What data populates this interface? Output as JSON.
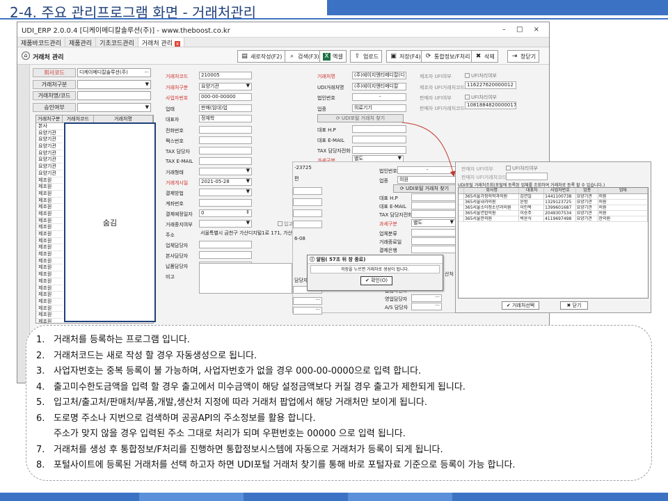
{
  "slide": {
    "title": "2-4. 주요 관리프로그램 화면 - 거래처관리"
  },
  "window": {
    "title": "UDI_ERP 2.0.0.4 [디케이메디칼솔루션(주)] - www.theboost.co.kr",
    "controls": "– □ ×",
    "menus": [
      "제품바코드관리",
      "제품관리",
      "기초코드관리",
      "거래처 관리"
    ],
    "active_close": "x",
    "screen_name": "거래처 관리"
  },
  "toolbar": [
    {
      "icon": "document-icon",
      "glyph": "▤",
      "label": "새로작성(F2)"
    },
    {
      "icon": "search-icon",
      "glyph": "⌕",
      "label": "검색(F3)"
    },
    {
      "icon": "excel-icon",
      "glyph": "X",
      "label": "엑셀"
    },
    {
      "icon": "upload-icon",
      "glyph": "⇪",
      "label": "업로드"
    },
    {
      "icon": "save-icon",
      "glyph": "▣",
      "label": "저장(F4)"
    },
    {
      "icon": "sync-icon",
      "glyph": "⟳",
      "label": "통합정보/F처리"
    },
    {
      "icon": "delete-icon",
      "glyph": "✖",
      "label": "삭제"
    },
    {
      "icon": "close-icon",
      "glyph": "⇥",
      "label": "창닫기"
    }
  ],
  "search": {
    "company_label": "회사코드",
    "company_value": "디케이메디칼솔루션(주)",
    "type_label": "거래처구분",
    "name_label": "거래처명/코드",
    "approve_label": "승인여부"
  },
  "left_grid": {
    "headers": [
      "거래처구분",
      "거래처코드",
      "거래처명"
    ],
    "rows": [
      "본사",
      "요양기관",
      "요양기관",
      "요양기관",
      "요양기관",
      "요양기관",
      "요양기관",
      "요양기관",
      "제조원",
      "제조원",
      "제조원",
      "제조원",
      "제조원",
      "제조원",
      "제조원",
      "제조원",
      "제조원",
      "제조원",
      "제조원",
      "제조원",
      "제조원",
      "제조원",
      "제조원",
      "제조원",
      "제조원",
      "제조원",
      "제조원",
      "제조원",
      "제조원",
      "제조원",
      "제조원",
      "제조원",
      "제조원",
      "제조원",
      "제조원",
      "제조원"
    ],
    "hidden_label": "숨김"
  },
  "form": {
    "code_label": "거래처코드",
    "code_value": "210005",
    "type_label": "거래처구분",
    "type_value": "요양기관",
    "bizno_label": "사업자번호",
    "bizno_value": "000-00-00000",
    "biztype_label": "업태",
    "biztype_value": "판매(임대)업",
    "ceo_label": "대표자",
    "ceo_value": "정재학",
    "tel_label": "전화번호",
    "fax_label": "팩스번호",
    "tax_mgr_label": "TAX 담당자",
    "tax_email_label": "TAX E-MAIL",
    "trade_type_label": "거래형태",
    "start_label": "거래개시일",
    "start_value": "2021-05-28",
    "pay_label": "결제방법",
    "account_label": "계좌번호",
    "pay_day_label": "결제예정일자",
    "pay_day_value": "0",
    "stop_label": "거래중지여부",
    "address_label": "주소",
    "address_value": "서울특별시 금천구 가산디지털1로 171, 가산",
    "biz_mgr_label": "업체담당자",
    "hq_mgr_label": "본사담당자",
    "deliv_mgr_label": "납품담당자",
    "memo_label": "비고",
    "name_label": "거래처명",
    "name_value": "(주)에이지엔티메디칼(디",
    "udi_name_label": "UDI거래처명",
    "udi_name_value": "(주)에이지엔티메디칼",
    "corp_label": "법인번호",
    "corp_value": "-",
    "industry_label": "업종",
    "industry_value": "의료기기",
    "udi_btn": "UDI포털 거래처 찾기",
    "rep_hp_label": "대표 H.P",
    "rep_email_label": "대표 E-MAIL",
    "tax_tel_label": "TAX 담당자전화",
    "tax_class_label": "과세구분",
    "tax_class_value": "별도",
    "in_chk": "입고",
    "maker_label": "제조자 UFI여부",
    "maker_chk": "UFI처리여부",
    "maker_code_label": "제조자 UFI거래처코드",
    "maker_code_value": "116227620000012",
    "seller_label": "판매자 UFI여부",
    "seller_chk": "UFI처리여부",
    "seller_code_label": "판매자 UFI거래처코드",
    "seller_code_value": "1081884820000017"
  },
  "overlay": {
    "f1": "-23725",
    "f2": "편",
    "date": "6-08",
    "partial_label": "담당자",
    "corp_label": "법인번호",
    "corp_value": "-",
    "industry_label": "업종",
    "industry_value": "의원",
    "udi_btn": "UDI포털 거래처 찾기",
    "rep_hp_label": "대표 H.P",
    "rep_email_label": "대표 E-MAIL",
    "tax_tel_label": "TAX 담당자전화",
    "tax_class_label": "과세구분",
    "tax_class_value": "별도",
    "biz_class_label": "업체분류",
    "trade_end_label": "거래종료일",
    "bank_label": "결제은행",
    "deliv_tel_label": "납품자전화",
    "sales_label": "영업담당자",
    "as_label": "A/S 담당자",
    "side_label": "산처"
  },
  "alert": {
    "title": "알림( 57초 뒤 창 종료)",
    "message": "저장을 누르면 거래처로 생성이 됩니다.",
    "ok": "확인(O)"
  },
  "udi_popup": {
    "seller_label": "판매자 UFI여부",
    "seller_chk": "UFI처리여부",
    "seller_code_label": "판매자 UFI거래처코드",
    "title": "UDI포털 거래처조회(포털에 등록된 업체를 조회하여 거래처로 등록 할 수 있습니다.)",
    "headers": [
      "회사명",
      "대표자",
      "사업자번호",
      "업종",
      "업태"
    ],
    "rows": [
      [
        "365서울가정의학과의원",
        "김연일",
        "1441100738",
        "요양기관",
        "의원"
      ],
      [
        "365서울내과의원",
        "윤범",
        "1329123725",
        "요양기관",
        "의원"
      ],
      [
        "365서울소아청소년과의원",
        "이인복",
        "1399601687",
        "요양기관",
        "의원"
      ],
      [
        "365서울연합의원",
        "이승주",
        "2049307534",
        "요양기관",
        "의원"
      ],
      [
        "365서울한의원",
        "박윤식",
        "4119697498",
        "요양기관",
        "한의원"
      ]
    ],
    "select_btn": "거래처선택",
    "close_btn": "닫기"
  },
  "notes": [
    "거래처를 등록하는 프로그램 입니다.",
    "거래처코드는 새로 작성 할 경우 자동생성으로 됩니다.",
    "사업자번호는 중복 등록이 불 가능하며,  사업자번호가 없을 경우 000-00-0000으로 입력 합니다.",
    "출고미수한도금액을 입력 할 경우 출고에서 미수금액이 해당 설정금액보다 커질 경우 출고가 제한되게 됩니다.",
    "입고처/출고처/판매처/부품,개발,생산처 지정에 따라 거래처 팝업에서 해당 거래처만 보이게 됩니다.",
    "도로명 주소나 지번으로 검색하며 공공API의 주소정보를 활용 합니다.",
    "거래처를 생성 후 통합정보/F처리를 진행하면 통합정보시스템에 자동으로 거래처가 등록이 되게 됩니다.",
    "포털사이트에 등록된 거래처를 선택 하고자 하면 UDI포털 거래처 찾기를 통해 바로 포털자료 기준으로 등록이 가능 합니다."
  ],
  "notes_sub": "주소가 맞지 않을 경우 입력된 주소 그대로 처리가 되며 우편번호는 00000 으로 입력 됩니다."
}
